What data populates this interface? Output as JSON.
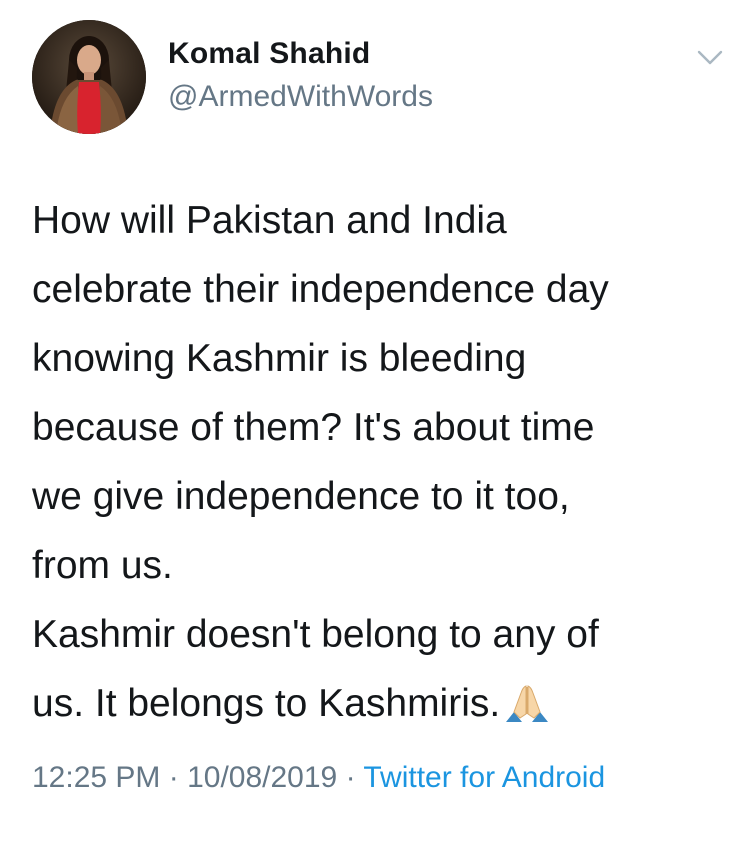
{
  "author": {
    "display_name": "Komal Shahid",
    "handle": "@ArmedWithWords"
  },
  "tweet": {
    "lines": [
      "How will Pakistan and India",
      "celebrate their independence day",
      "knowing Kashmir is bleeding",
      "because of them? It's about time",
      "we give independence to it too,",
      "from us.",
      "Kashmir doesn't belong to any of",
      "us. It belongs to Kashmiris."
    ],
    "emoji": "folded-hands",
    "time": "12:25 PM",
    "separator": " · ",
    "date": "10/08/2019",
    "source": "Twitter for Android"
  },
  "colors": {
    "text": "#14171a",
    "secondary": "#657786",
    "link": "#1b95e0"
  }
}
